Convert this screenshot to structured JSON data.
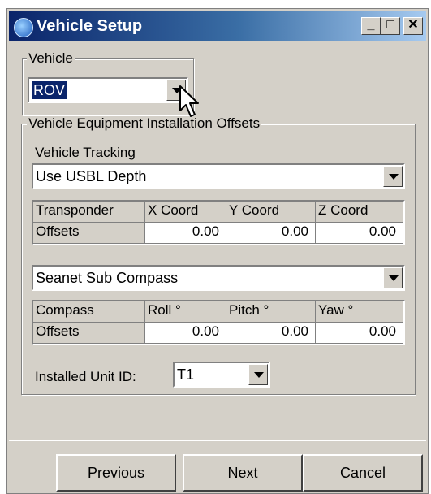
{
  "window": {
    "title": "Vehicle Setup",
    "minimize": "_",
    "maximize": "□",
    "close": "✕"
  },
  "vehicle_group": {
    "label": "Vehicle",
    "selected": "ROV"
  },
  "offsets_group": {
    "label": "Vehicle Equipment Installation Offsets",
    "tracking_label": "Vehicle Tracking",
    "tracking_selected": "Use USBL Depth",
    "transponder_grid": {
      "headers": [
        "Transponder",
        "X Coord",
        "Y Coord",
        "Z Coord"
      ],
      "row_label": "Offsets",
      "values": [
        "0.00",
        "0.00",
        "0.00"
      ]
    },
    "compass_selected": "Seanet Sub Compass",
    "compass_grid": {
      "headers": [
        "Compass",
        "Roll °",
        "Pitch °",
        "Yaw °"
      ],
      "row_label": "Offsets",
      "values": [
        "0.00",
        "0.00",
        "0.00"
      ]
    },
    "unit_id_label": "Installed Unit ID:",
    "unit_id_selected": "T1"
  },
  "buttons": {
    "previous": "Previous",
    "next": "Next",
    "cancel": "Cancel"
  },
  "colors": {
    "titlebar_start": "#0a246a",
    "titlebar_end": "#a6caf0",
    "face": "#d4d0c8",
    "selection": "#0a246a"
  }
}
